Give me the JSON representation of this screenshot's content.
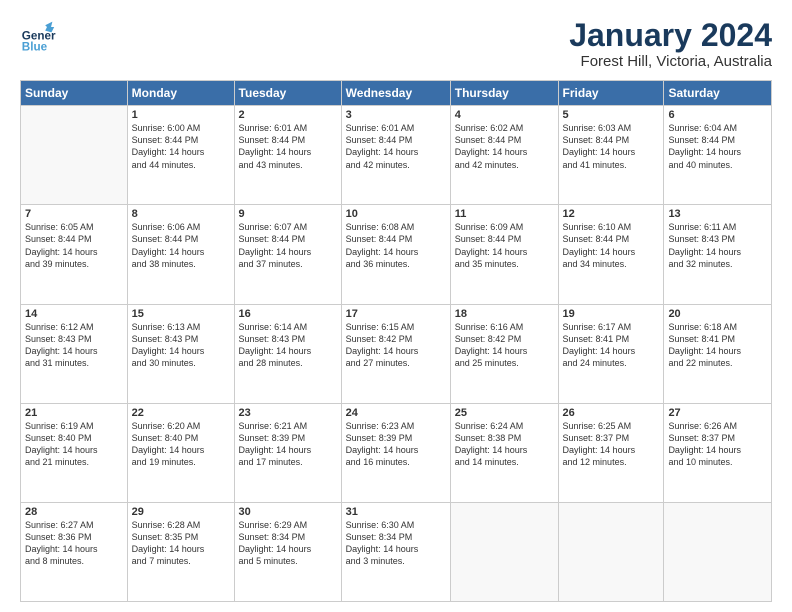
{
  "header": {
    "logo_general": "General",
    "logo_blue": "Blue",
    "title": "January 2024",
    "subtitle": "Forest Hill, Victoria, Australia"
  },
  "calendar": {
    "days_of_week": [
      "Sunday",
      "Monday",
      "Tuesday",
      "Wednesday",
      "Thursday",
      "Friday",
      "Saturday"
    ],
    "weeks": [
      [
        {
          "day": "",
          "info": ""
        },
        {
          "day": "1",
          "info": "Sunrise: 6:00 AM\nSunset: 8:44 PM\nDaylight: 14 hours\nand 44 minutes."
        },
        {
          "day": "2",
          "info": "Sunrise: 6:01 AM\nSunset: 8:44 PM\nDaylight: 14 hours\nand 43 minutes."
        },
        {
          "day": "3",
          "info": "Sunrise: 6:01 AM\nSunset: 8:44 PM\nDaylight: 14 hours\nand 42 minutes."
        },
        {
          "day": "4",
          "info": "Sunrise: 6:02 AM\nSunset: 8:44 PM\nDaylight: 14 hours\nand 42 minutes."
        },
        {
          "day": "5",
          "info": "Sunrise: 6:03 AM\nSunset: 8:44 PM\nDaylight: 14 hours\nand 41 minutes."
        },
        {
          "day": "6",
          "info": "Sunrise: 6:04 AM\nSunset: 8:44 PM\nDaylight: 14 hours\nand 40 minutes."
        }
      ],
      [
        {
          "day": "7",
          "info": "Sunrise: 6:05 AM\nSunset: 8:44 PM\nDaylight: 14 hours\nand 39 minutes."
        },
        {
          "day": "8",
          "info": "Sunrise: 6:06 AM\nSunset: 8:44 PM\nDaylight: 14 hours\nand 38 minutes."
        },
        {
          "day": "9",
          "info": "Sunrise: 6:07 AM\nSunset: 8:44 PM\nDaylight: 14 hours\nand 37 minutes."
        },
        {
          "day": "10",
          "info": "Sunrise: 6:08 AM\nSunset: 8:44 PM\nDaylight: 14 hours\nand 36 minutes."
        },
        {
          "day": "11",
          "info": "Sunrise: 6:09 AM\nSunset: 8:44 PM\nDaylight: 14 hours\nand 35 minutes."
        },
        {
          "day": "12",
          "info": "Sunrise: 6:10 AM\nSunset: 8:44 PM\nDaylight: 14 hours\nand 34 minutes."
        },
        {
          "day": "13",
          "info": "Sunrise: 6:11 AM\nSunset: 8:43 PM\nDaylight: 14 hours\nand 32 minutes."
        }
      ],
      [
        {
          "day": "14",
          "info": "Sunrise: 6:12 AM\nSunset: 8:43 PM\nDaylight: 14 hours\nand 31 minutes."
        },
        {
          "day": "15",
          "info": "Sunrise: 6:13 AM\nSunset: 8:43 PM\nDaylight: 14 hours\nand 30 minutes."
        },
        {
          "day": "16",
          "info": "Sunrise: 6:14 AM\nSunset: 8:43 PM\nDaylight: 14 hours\nand 28 minutes."
        },
        {
          "day": "17",
          "info": "Sunrise: 6:15 AM\nSunset: 8:42 PM\nDaylight: 14 hours\nand 27 minutes."
        },
        {
          "day": "18",
          "info": "Sunrise: 6:16 AM\nSunset: 8:42 PM\nDaylight: 14 hours\nand 25 minutes."
        },
        {
          "day": "19",
          "info": "Sunrise: 6:17 AM\nSunset: 8:41 PM\nDaylight: 14 hours\nand 24 minutes."
        },
        {
          "day": "20",
          "info": "Sunrise: 6:18 AM\nSunset: 8:41 PM\nDaylight: 14 hours\nand 22 minutes."
        }
      ],
      [
        {
          "day": "21",
          "info": "Sunrise: 6:19 AM\nSunset: 8:40 PM\nDaylight: 14 hours\nand 21 minutes."
        },
        {
          "day": "22",
          "info": "Sunrise: 6:20 AM\nSunset: 8:40 PM\nDaylight: 14 hours\nand 19 minutes."
        },
        {
          "day": "23",
          "info": "Sunrise: 6:21 AM\nSunset: 8:39 PM\nDaylight: 14 hours\nand 17 minutes."
        },
        {
          "day": "24",
          "info": "Sunrise: 6:23 AM\nSunset: 8:39 PM\nDaylight: 14 hours\nand 16 minutes."
        },
        {
          "day": "25",
          "info": "Sunrise: 6:24 AM\nSunset: 8:38 PM\nDaylight: 14 hours\nand 14 minutes."
        },
        {
          "day": "26",
          "info": "Sunrise: 6:25 AM\nSunset: 8:37 PM\nDaylight: 14 hours\nand 12 minutes."
        },
        {
          "day": "27",
          "info": "Sunrise: 6:26 AM\nSunset: 8:37 PM\nDaylight: 14 hours\nand 10 minutes."
        }
      ],
      [
        {
          "day": "28",
          "info": "Sunrise: 6:27 AM\nSunset: 8:36 PM\nDaylight: 14 hours\nand 8 minutes."
        },
        {
          "day": "29",
          "info": "Sunrise: 6:28 AM\nSunset: 8:35 PM\nDaylight: 14 hours\nand 7 minutes."
        },
        {
          "day": "30",
          "info": "Sunrise: 6:29 AM\nSunset: 8:34 PM\nDaylight: 14 hours\nand 5 minutes."
        },
        {
          "day": "31",
          "info": "Sunrise: 6:30 AM\nSunset: 8:34 PM\nDaylight: 14 hours\nand 3 minutes."
        },
        {
          "day": "",
          "info": ""
        },
        {
          "day": "",
          "info": ""
        },
        {
          "day": "",
          "info": ""
        }
      ]
    ]
  }
}
